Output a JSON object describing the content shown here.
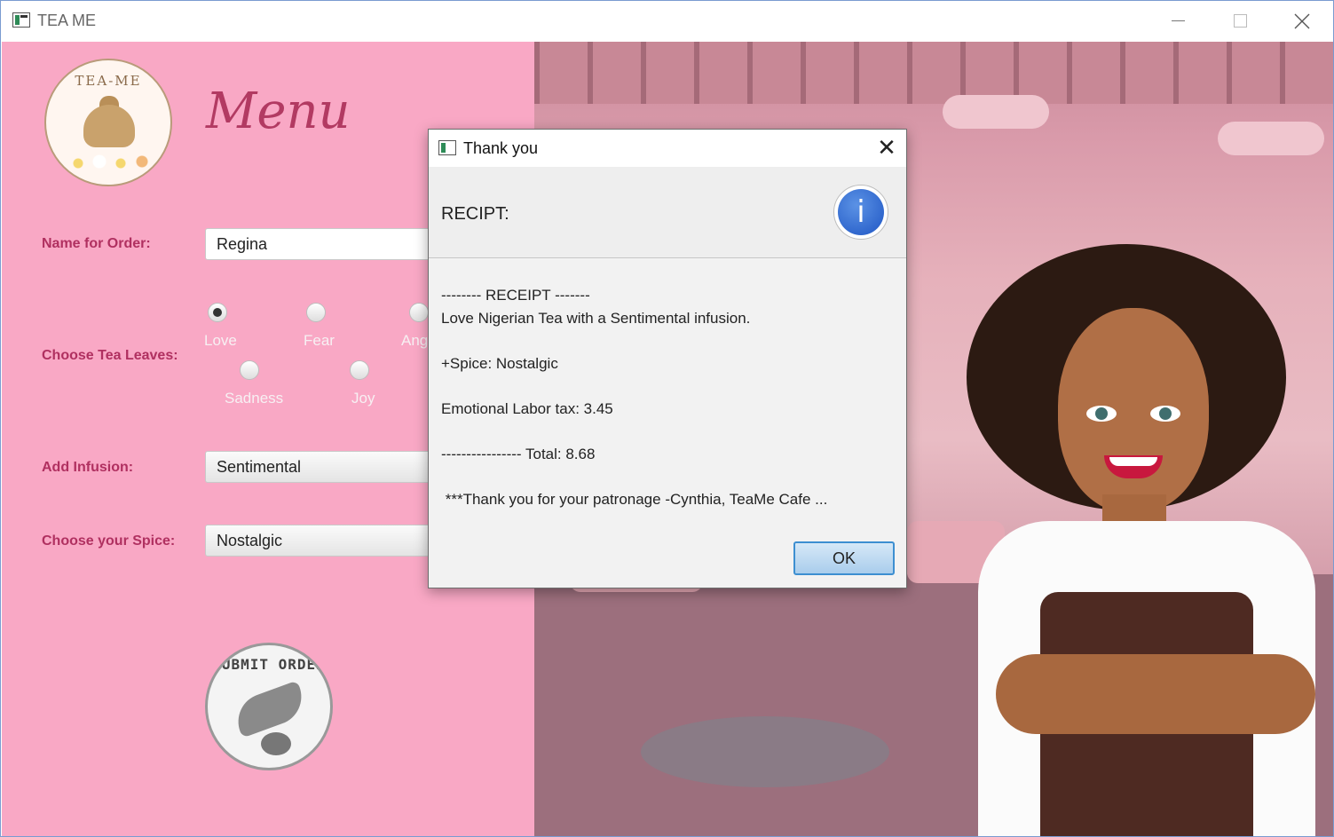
{
  "window": {
    "title": "TEA ME"
  },
  "menu": {
    "logo_text": "TEA-ME",
    "title": "Menu",
    "name_label": "Name for Order:",
    "name_value": "Regina",
    "tea_label": "Choose Tea Leaves:",
    "tea_options": [
      "Love",
      "Fear",
      "Ang",
      "Sadness",
      "Joy"
    ],
    "tea_selected": "Love",
    "infusion_label": "Add Infusion:",
    "infusion_value": "Sentimental",
    "spice_label": "Choose your Spice:",
    "spice_value": "Nostalgic",
    "submit_text": "SUBMIT ORDER"
  },
  "dialog": {
    "title": "Thank you",
    "close_glyph": "✕",
    "header": "RECIPT:",
    "info_glyph": "i",
    "lines": [
      "-------- RECEIPT -------",
      "Love Nigerian Tea with a Sentimental infusion.",
      "",
      "+Spice: Nostalgic",
      "",
      "Emotional Labor tax: 3.45",
      "",
      "---------------- Total: 8.68",
      "",
      " ***Thank you for your patronage -Cynthia, TeaMe Cafe ..."
    ],
    "ok_label": "OK"
  },
  "colors": {
    "panel_pink": "#f9a8c5",
    "label_red": "#b03060",
    "menu_title": "#b23a62",
    "ok_border": "#3d8fd1"
  },
  "icons": {
    "app": "java-app-icon",
    "info": "info-icon",
    "close": "close-icon",
    "minimize": "minimize-icon",
    "maximize": "maximize-icon"
  }
}
